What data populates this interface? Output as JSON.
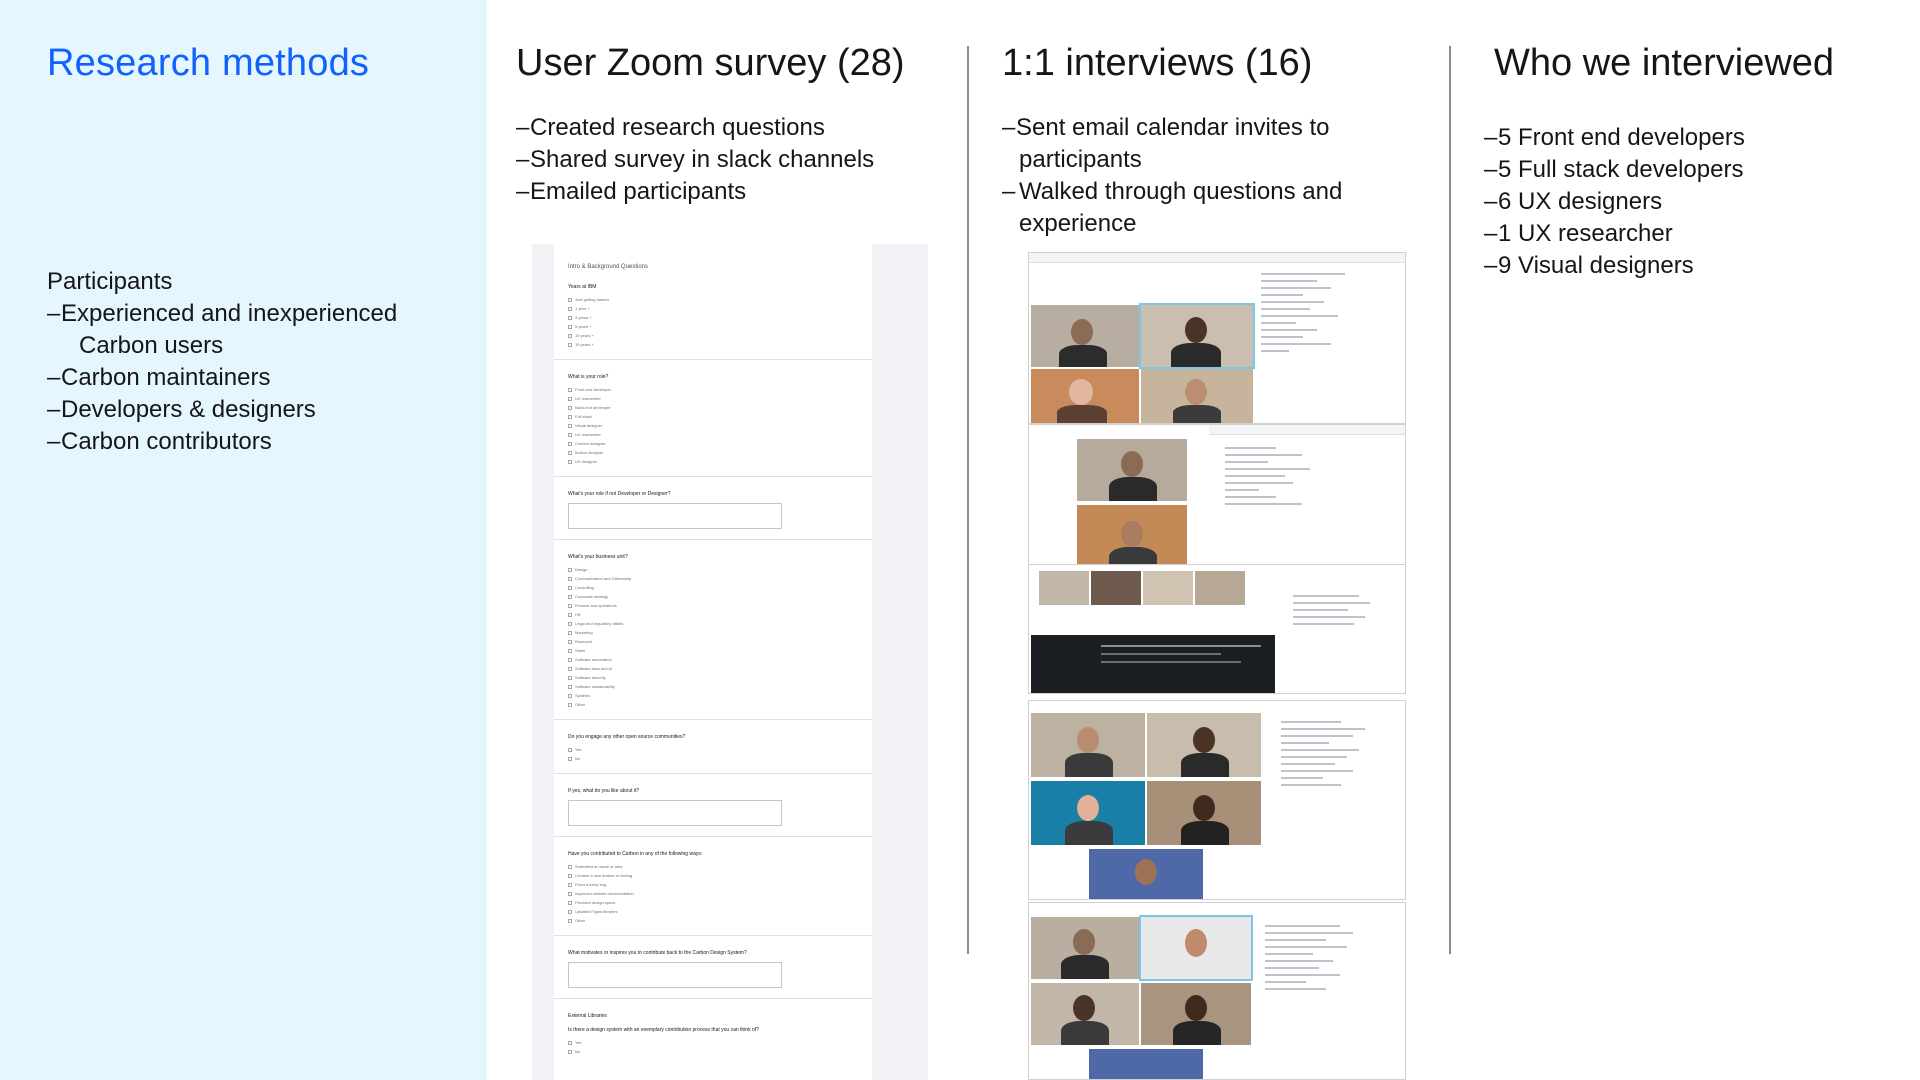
{
  "left": {
    "title": "Research methods",
    "participants_heading": "Participants",
    "participants": [
      "Experienced and inexperienced",
      "Carbon users",
      "Carbon maintainers",
      "Developers & designers",
      "Carbon contributors"
    ],
    "accent_color": "#0f62fe",
    "panel_color": "#e5f6ff"
  },
  "survey": {
    "title": "User Zoom survey (28)",
    "items": [
      "Created research questions",
      "Shared survey in slack channels",
      "Emailed participants"
    ],
    "screenshot": {
      "heading": "Intro & Background Questions",
      "q1": "Years at IBM",
      "q1_options": [
        "Just getting started",
        "1 year +",
        "3 years +",
        "5 years +",
        "10 years +",
        "15 years +"
      ],
      "q2": "What is your role?",
      "q2_options": [
        "Front-end developer",
        "UX researcher",
        "Back-end developer",
        "Full stack",
        "Visual designer",
        "UX researcher",
        "Content designer",
        "Motion designer",
        "UX designer"
      ],
      "q3": "What's your role if not Developer or Designer?",
      "q4": "What's your business unit?",
      "q4_options": [
        "Design",
        "Communication and Citizenship",
        "Consulting",
        "Corporate strategy",
        "Finance and operations",
        "HR",
        "Legal and regulatory affairs",
        "Marketing",
        "Research",
        "Sales",
        "Software automation",
        "Software data and AI",
        "Software security",
        "Software sustainability",
        "Systems",
        "Other"
      ],
      "q5": "Do you engage any other open source communities?",
      "q5_options": [
        "Yes",
        "No"
      ],
      "q6": "If yes, what do you like about it?",
      "q7": "Have you contributed to Carbon in any of the following ways:",
      "q7_options": [
        "Submitted an issue or idea",
        "Created a new feature or fix/bug",
        "Fixed a tricky bug",
        "Improved website documentation",
        "Provided design specs",
        "Updated Figma libraries",
        "Other"
      ],
      "q8": "What motivates or inspires you to contribute back to the Carbon Design System?",
      "section2": "External Libraries",
      "q9": "Is there a design system with an exemplary contribution process that you can think of?",
      "q9_options": [
        "Yes",
        "No"
      ]
    }
  },
  "interviews": {
    "title": "1:1 interviews (16)",
    "items": [
      "Sent email calendar invites to",
      "participants",
      "Walked through questions and",
      "experience"
    ]
  },
  "interviewed": {
    "title": "Who we interviewed",
    "items": [
      "5 Front end developers",
      "5 Full stack developers",
      "6 UX designers",
      "1 UX researcher",
      "9 Visual designers"
    ]
  }
}
